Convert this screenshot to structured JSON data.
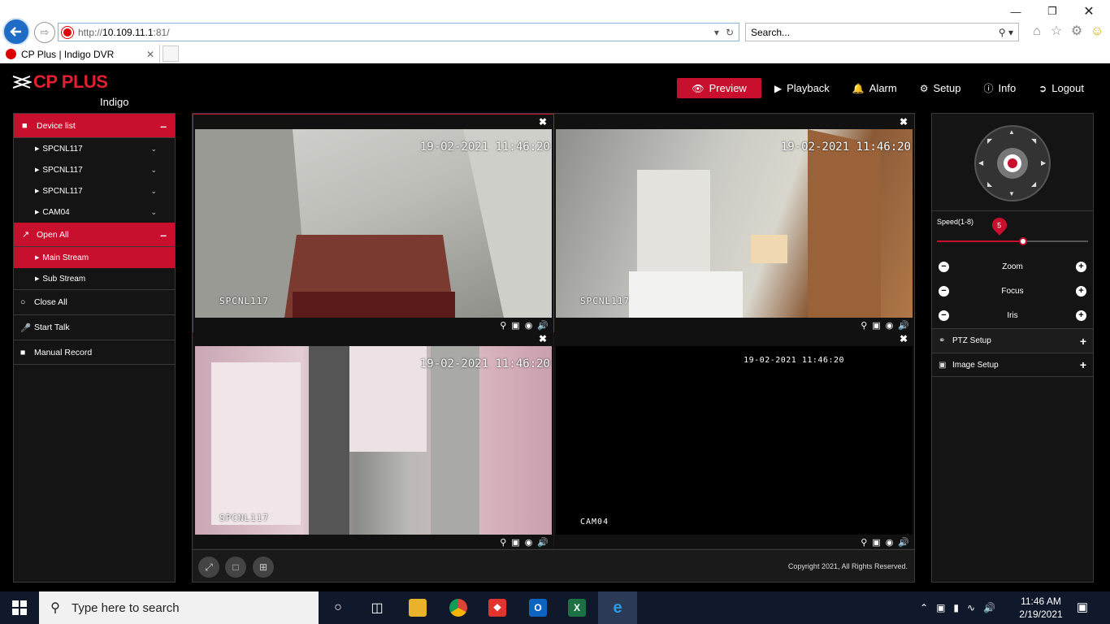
{
  "browser": {
    "url_prefix": "http://",
    "url_host": "10.109.11.1",
    "url_rest": ":81/",
    "search_placeholder": "Search...",
    "tab_title": "CP Plus | Indigo DVR"
  },
  "header": {
    "brand": "CP PLUS",
    "brand_sub": "Indigo",
    "nav": [
      {
        "label": "Preview",
        "icon": "eye-icon",
        "active": true
      },
      {
        "label": "Playback",
        "icon": "play-icon"
      },
      {
        "label": "Alarm",
        "icon": "bell-icon"
      },
      {
        "label": "Setup",
        "icon": "gear-icon"
      },
      {
        "label": "Info",
        "icon": "info-icon"
      },
      {
        "label": "Logout",
        "icon": "logout-icon"
      }
    ]
  },
  "sidebar": {
    "device_list_label": "Device list",
    "devices": [
      "SPCNL117",
      "SPCNL117",
      "SPCNL117",
      "CAM04"
    ],
    "open_all_label": "Open All",
    "streams": [
      "Main Stream",
      "Sub Stream"
    ],
    "close_all_label": "Close All",
    "start_talk_label": "Start Talk",
    "manual_record_label": "Manual Record"
  },
  "views": [
    {
      "timestamp": "19-02-2021 11:46:20",
      "name": "SPCNL117",
      "selected": true
    },
    {
      "timestamp": "19-02-2021 11:46:20",
      "name": "SPCNL117"
    },
    {
      "timestamp": "19-02-2021 11:46:20",
      "name": "SPCNL117"
    },
    {
      "timestamp": "19-02-2021 11:46:20",
      "name": "CAM04"
    }
  ],
  "center_footer": {
    "copyright": "Copyright 2021, All Rights Reserved."
  },
  "ptz": {
    "speed_label": "Speed(1-8)",
    "speed_value": "5",
    "speed_fraction": 0.57,
    "zoom_label": "Zoom",
    "focus_label": "Focus",
    "iris_label": "Iris",
    "ptz_setup_label": "PTZ Setup",
    "image_setup_label": "Image Setup"
  },
  "taskbar": {
    "search_placeholder": "Type here to search",
    "time": "11:46 AM",
    "date": "2/19/2021"
  },
  "colors": {
    "accent": "#c8102e",
    "panel": "#141414",
    "taskbar": "#10192b"
  }
}
